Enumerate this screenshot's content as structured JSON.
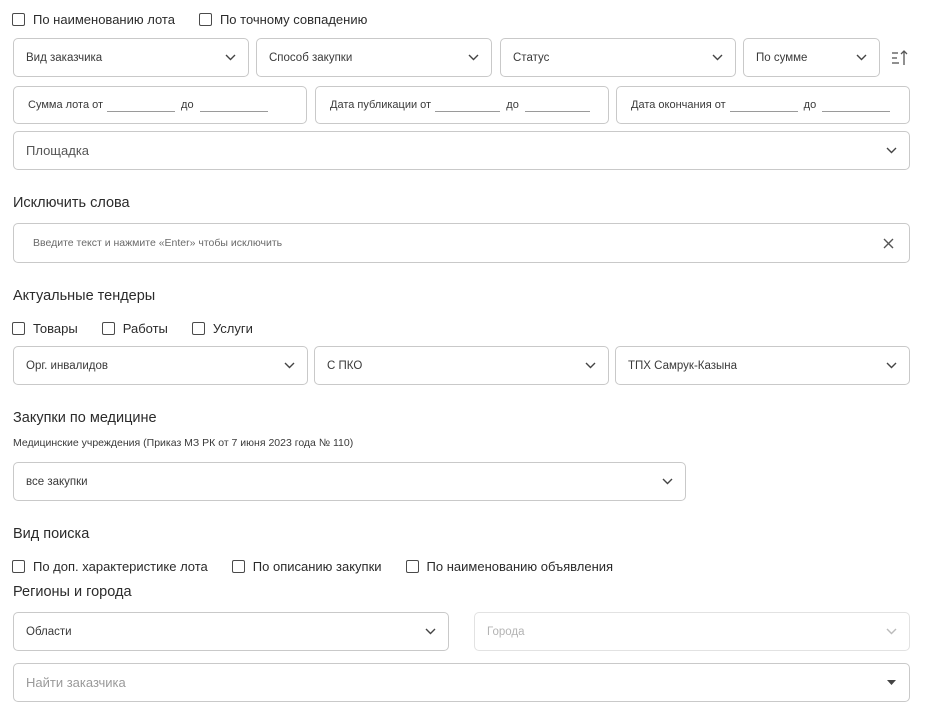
{
  "top_checkboxes": [
    {
      "label": "По наименованию лота"
    },
    {
      "label": "По точному совпадению"
    }
  ],
  "filters": {
    "customer_type": "Вид заказчика",
    "purchase_method": "Способ закупки",
    "status": "Статус",
    "sort": "По сумме"
  },
  "ranges": {
    "amount": {
      "label": "Сумма лота от",
      "to": "до"
    },
    "pub_date": {
      "label": "Дата публикации от",
      "to": "до"
    },
    "end_date": {
      "label": "Дата окончания от",
      "to": "до"
    }
  },
  "platform": {
    "placeholder": "Площадка"
  },
  "exclude": {
    "title": "Исключить слова",
    "placeholder": "Введите текст и нажмите «Enter» чтобы исключить"
  },
  "actual": {
    "title": "Актуальные тендеры",
    "checkboxes": [
      {
        "label": "Товары"
      },
      {
        "label": "Работы"
      },
      {
        "label": "Услуги"
      }
    ],
    "selects": [
      "Орг. инвалидов",
      "С ПКО",
      "ТПХ Самрук-Казына"
    ]
  },
  "medicine": {
    "title": "Закупки по медицине",
    "subtitle": "Медицинские учреждения (Приказ МЗ РК от 7 июня 2023 года № 110)",
    "select": "все закупки"
  },
  "search_type": {
    "title": "Вид поиска",
    "checkboxes": [
      {
        "label": "По доп. характеристике лота"
      },
      {
        "label": "По описанию закупки"
      },
      {
        "label": "По наименованию объявления"
      }
    ]
  },
  "regions": {
    "title": "Регионы и города",
    "regions_select": "Области",
    "cities_select": "Города"
  },
  "customer_search": {
    "placeholder": "Найти заказчика"
  },
  "colors": {
    "border": "#c9c9c9",
    "text": "#2b2b2b",
    "disabled": "#b3b3b3"
  }
}
